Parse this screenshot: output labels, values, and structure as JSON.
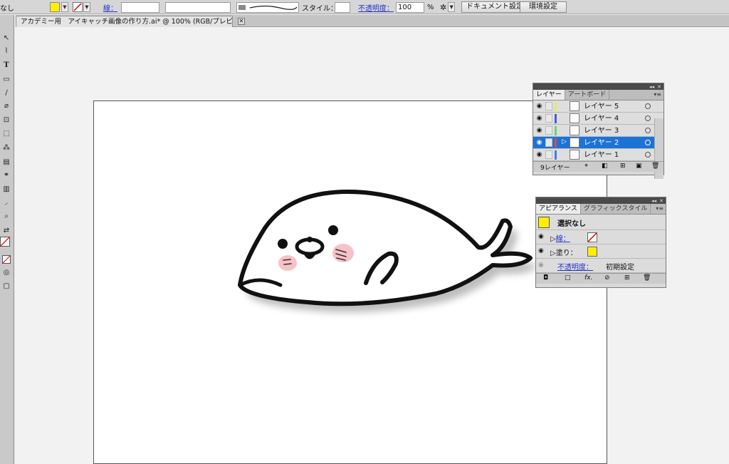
{
  "control_bar": {
    "selection_label": "なし",
    "stroke_label": "線：",
    "style_label": "スタイル：",
    "opacity_label": "不透明度：",
    "opacity_value": "100",
    "opacity_unit": "%",
    "doc_settings_button": "ドキュメント設定",
    "prefs_button": "環境設定",
    "fill_color": "#ffee00"
  },
  "document": {
    "tab_title": "アカデミー用　アイキャッチ画像の作り方.ai* @ 100% (RGB/プレビュー)"
  },
  "toolbar": {
    "tools": [
      "selection-tool",
      "direct-selection-tool",
      "type-tool",
      "rectangle-tool",
      "pen-tool",
      "paintbrush-tool",
      "eraser-tool",
      "rotate-tool",
      "free-transform-tool",
      "symbol-sprayer-tool",
      "gradient-tool",
      "blend-tool",
      "graph-tool",
      "eyedropper-tool",
      "zoom-tool"
    ]
  },
  "layers_panel": {
    "tabs": [
      "レイヤー",
      "アートボード"
    ],
    "layers": [
      {
        "name": "レイヤー 5",
        "color": "#e8e86a",
        "selected": false
      },
      {
        "name": "レイヤー 4",
        "color": "#4a5adc",
        "selected": false
      },
      {
        "name": "レイヤー 3",
        "color": "#67d96a",
        "selected": false
      },
      {
        "name": "レイヤー 2",
        "color": "#e04848",
        "selected": true
      },
      {
        "name": "レイヤー 1",
        "color": "#4a7ae0",
        "selected": false
      }
    ],
    "footer": "9レイヤー"
  },
  "appearance_panel": {
    "tabs": [
      "アピアランス",
      "グラフィックスタイル"
    ],
    "header": "選択なし",
    "stroke_label": "線：",
    "fill_label": "塗り：",
    "opacity_label": "不透明度：",
    "opacity_value": "初期設定",
    "fill_color": "#ffee00"
  }
}
